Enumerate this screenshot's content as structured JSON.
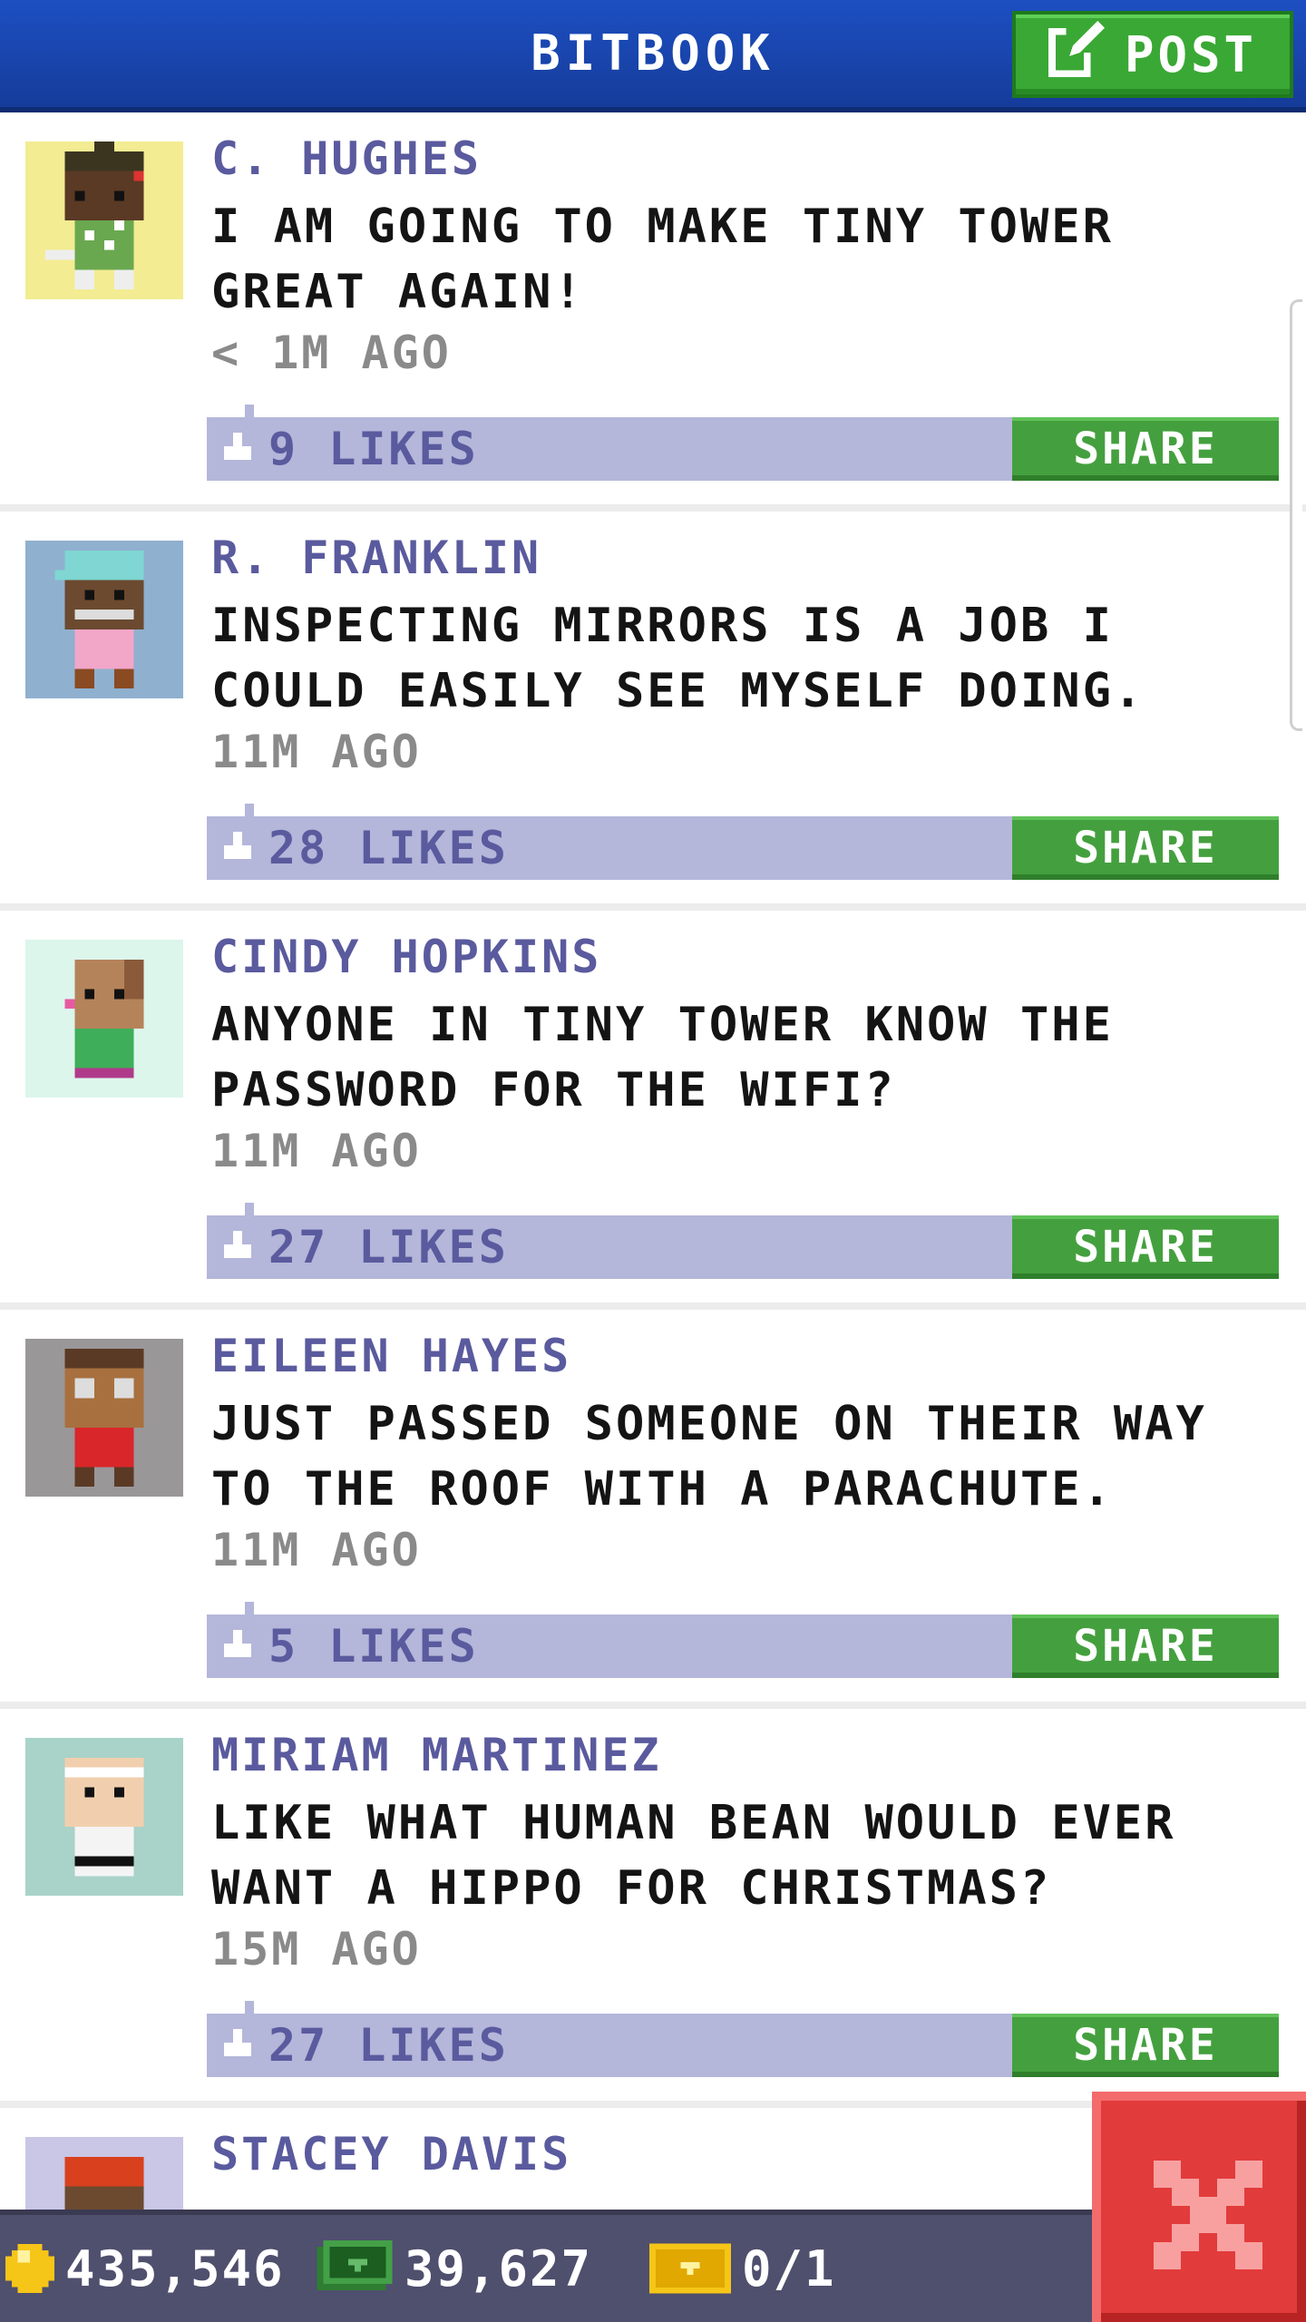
{
  "header": {
    "title": "BITBOOK",
    "post_label": "POST"
  },
  "posts": [
    {
      "author": "C. HUGHES",
      "message": "I AM GOING TO MAKE TINY TOWER GREAT AGAIN!",
      "time": "< 1M AGO",
      "likes": "9 LIKES",
      "share_label": "SHARE",
      "avatar_bg": "#f3ec92"
    },
    {
      "author": "R. FRANKLIN",
      "message": "INSPECTING MIRRORS IS A JOB I COULD EASILY SEE MYSELF DOING.",
      "time": "11M AGO",
      "likes": "28 LIKES",
      "share_label": "SHARE",
      "avatar_bg": "#8fb0cf"
    },
    {
      "author": "CINDY HOPKINS",
      "message": "ANYONE IN TINY TOWER KNOW THE PASSWORD FOR THE WIFI?",
      "time": "11M AGO",
      "likes": "27 LIKES",
      "share_label": "SHARE",
      "avatar_bg": "#dcf6ec"
    },
    {
      "author": "EILEEN HAYES",
      "message": "JUST PASSED SOMEONE ON THEIR WAY TO THE ROOF WITH A PARACHUTE.",
      "time": "11M AGO",
      "likes": "5 LIKES",
      "share_label": "SHARE",
      "avatar_bg": "#9a9799"
    },
    {
      "author": "MIRIAM MARTINEZ",
      "message": "LIKE WHAT HUMAN BEAN WOULD EVER WANT A HIPPO FOR CHRISTMAS?",
      "time": "15M AGO",
      "likes": "27 LIKES",
      "share_label": "SHARE",
      "avatar_bg": "#a9d2c8"
    },
    {
      "author": "STACEY DAVIS",
      "avatar_bg": "#c9c6e6"
    }
  ],
  "status_bar": {
    "coins": "435,546",
    "bux": "39,627",
    "tickets": "0/1"
  },
  "colors": {
    "header_blue": "#1d4fc2",
    "post_green": "#3aa834",
    "likes_bar": "#b4b6da",
    "author_purple": "#5a5a9e",
    "close_red": "#e23b3b"
  },
  "icons": {
    "post": "edit-icon",
    "like": "thumbs-up-icon",
    "coin": "coin-icon",
    "bux": "bux-icon",
    "ticket": "ticket-icon",
    "close": "close-icon"
  }
}
